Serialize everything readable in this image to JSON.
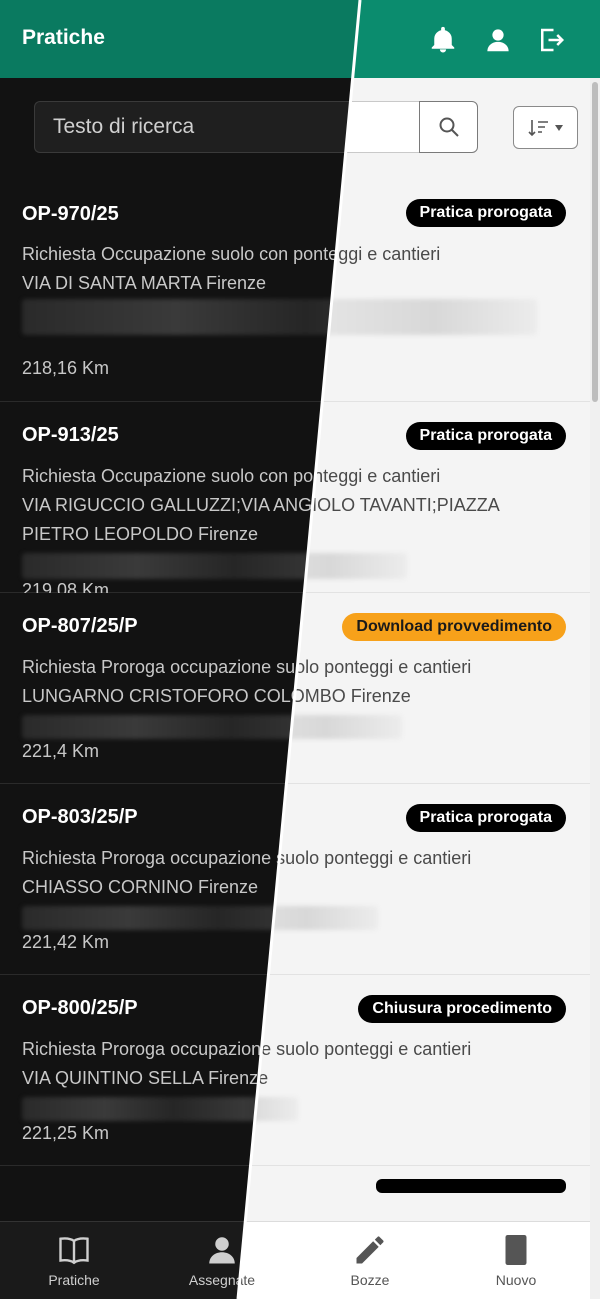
{
  "header": {
    "title": "Pratiche"
  },
  "search": {
    "placeholder": "Testo di ricerca"
  },
  "items": [
    {
      "code": "OP-970/25",
      "badge": "Pratica prorogata",
      "type": "Richiesta Occupazione suolo con ponteggi e cantieri",
      "address": "VIA DI SANTA MARTA Firenze",
      "distance": "218,16 Km"
    },
    {
      "code": "OP-913/25",
      "badge": "Pratica prorogata",
      "type": "Richiesta Occupazione suolo con ponteggi e cantieri",
      "address": "VIA RIGUCCIO GALLUZZI;VIA ANGIOLO TAVANTI;PIAZZA PIETRO LEOPOLDO Firenze",
      "distance": "219,08 Km"
    },
    {
      "code": "OP-807/25/P",
      "badge": "Download provvedimento",
      "type": "Richiesta Proroga occupazione suolo ponteggi e cantieri",
      "address": "LUNGARNO CRISTOFORO COLOMBO Firenze",
      "distance": "221,4 Km"
    },
    {
      "code": "OP-803/25/P",
      "badge": "Pratica prorogata",
      "type": "Richiesta Proroga occupazione suolo ponteggi e cantieri",
      "address": "CHIASSO CORNINO Firenze",
      "distance": "221,42 Km"
    },
    {
      "code": "OP-800/25/P",
      "badge": "Chiusura procedimento",
      "type": "Richiesta Proroga occupazione suolo ponteggi e cantieri",
      "address": "VIA QUINTINO SELLA Firenze",
      "distance": "221,25 Km"
    }
  ],
  "nav": {
    "pratiche": "Pratiche",
    "assegnate": "Assegnate",
    "bozze": "Bozze",
    "nuovo": "Nuovo"
  },
  "colors": {
    "header": "#0b8c6e",
    "badge_dark": "#000000",
    "badge_orange": "#f7a11a"
  },
  "icons": [
    "bell-icon",
    "user-icon",
    "logout-icon",
    "search-icon",
    "sort-icon",
    "book-icon",
    "person-icon",
    "pencil-icon",
    "document-icon"
  ]
}
